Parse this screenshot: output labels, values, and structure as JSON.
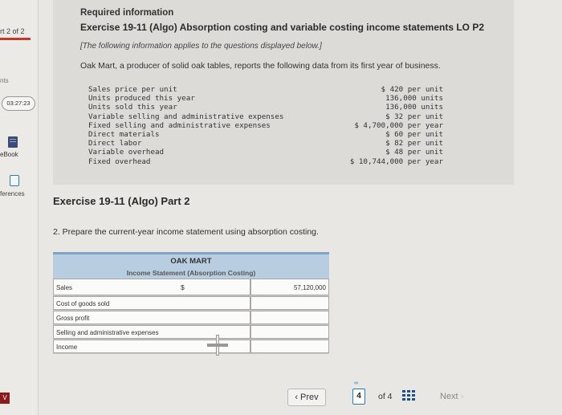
{
  "sidebar": {
    "part_label": "rt 2 of 2",
    "points_label": "nts",
    "timer": "03:27:23",
    "ebook_label": "eBook",
    "references_label": "ferences",
    "footer_badge": "V"
  },
  "info": {
    "heading": "Required information",
    "exercise_title": "Exercise 19-11 (Algo) Absorption costing and variable costing income statements LO P2",
    "note": "[The following information applies to the questions displayed below.]",
    "intro": "Oak Mart, a producer of solid oak tables, reports the following data from its first year of business.",
    "data_rows": [
      {
        "label": "Sales price per unit",
        "value": "$ 420 per unit"
      },
      {
        "label": "Units produced this year",
        "value": "136,000 units"
      },
      {
        "label": "Units sold this year",
        "value": "136,000 units"
      },
      {
        "label": "Variable selling and administrative expenses",
        "value": "$ 32 per unit"
      },
      {
        "label": "Fixed selling and administrative expenses",
        "value": "$ 4,700,000 per year"
      },
      {
        "label": "Direct materials",
        "value": "$ 60 per unit"
      },
      {
        "label": "Direct labor",
        "value": "$ 82 per unit"
      },
      {
        "label": "Variable overhead",
        "value": "$ 48 per unit"
      },
      {
        "label": "Fixed overhead",
        "value": "$ 10,744,000 per year"
      }
    ]
  },
  "part": {
    "title": "Exercise 19-11 (Algo) Part 2",
    "question": "2. Prepare the current-year income statement using absorption costing."
  },
  "statement": {
    "company": "OAK MART",
    "subtitle": "Income Statement (Absorption Costing)",
    "rows": [
      {
        "label": "Sales",
        "currency": "$",
        "value": "57,120,000"
      },
      {
        "label": "Cost of goods sold",
        "currency": "",
        "value": ""
      },
      {
        "label": "Gross profit",
        "currency": "",
        "value": ""
      },
      {
        "label": "Selling and administrative expenses",
        "currency": "",
        "value": ""
      },
      {
        "label": "Income",
        "currency": "",
        "value": ""
      }
    ]
  },
  "nav": {
    "prev_label": "Prev",
    "current_page": "4",
    "of_label": "of 4",
    "next_label": "Next"
  },
  "colors": {
    "table_header": "#b9cde0",
    "accent_blue": "#1f7fb8",
    "part_bar": "#c0392b"
  }
}
